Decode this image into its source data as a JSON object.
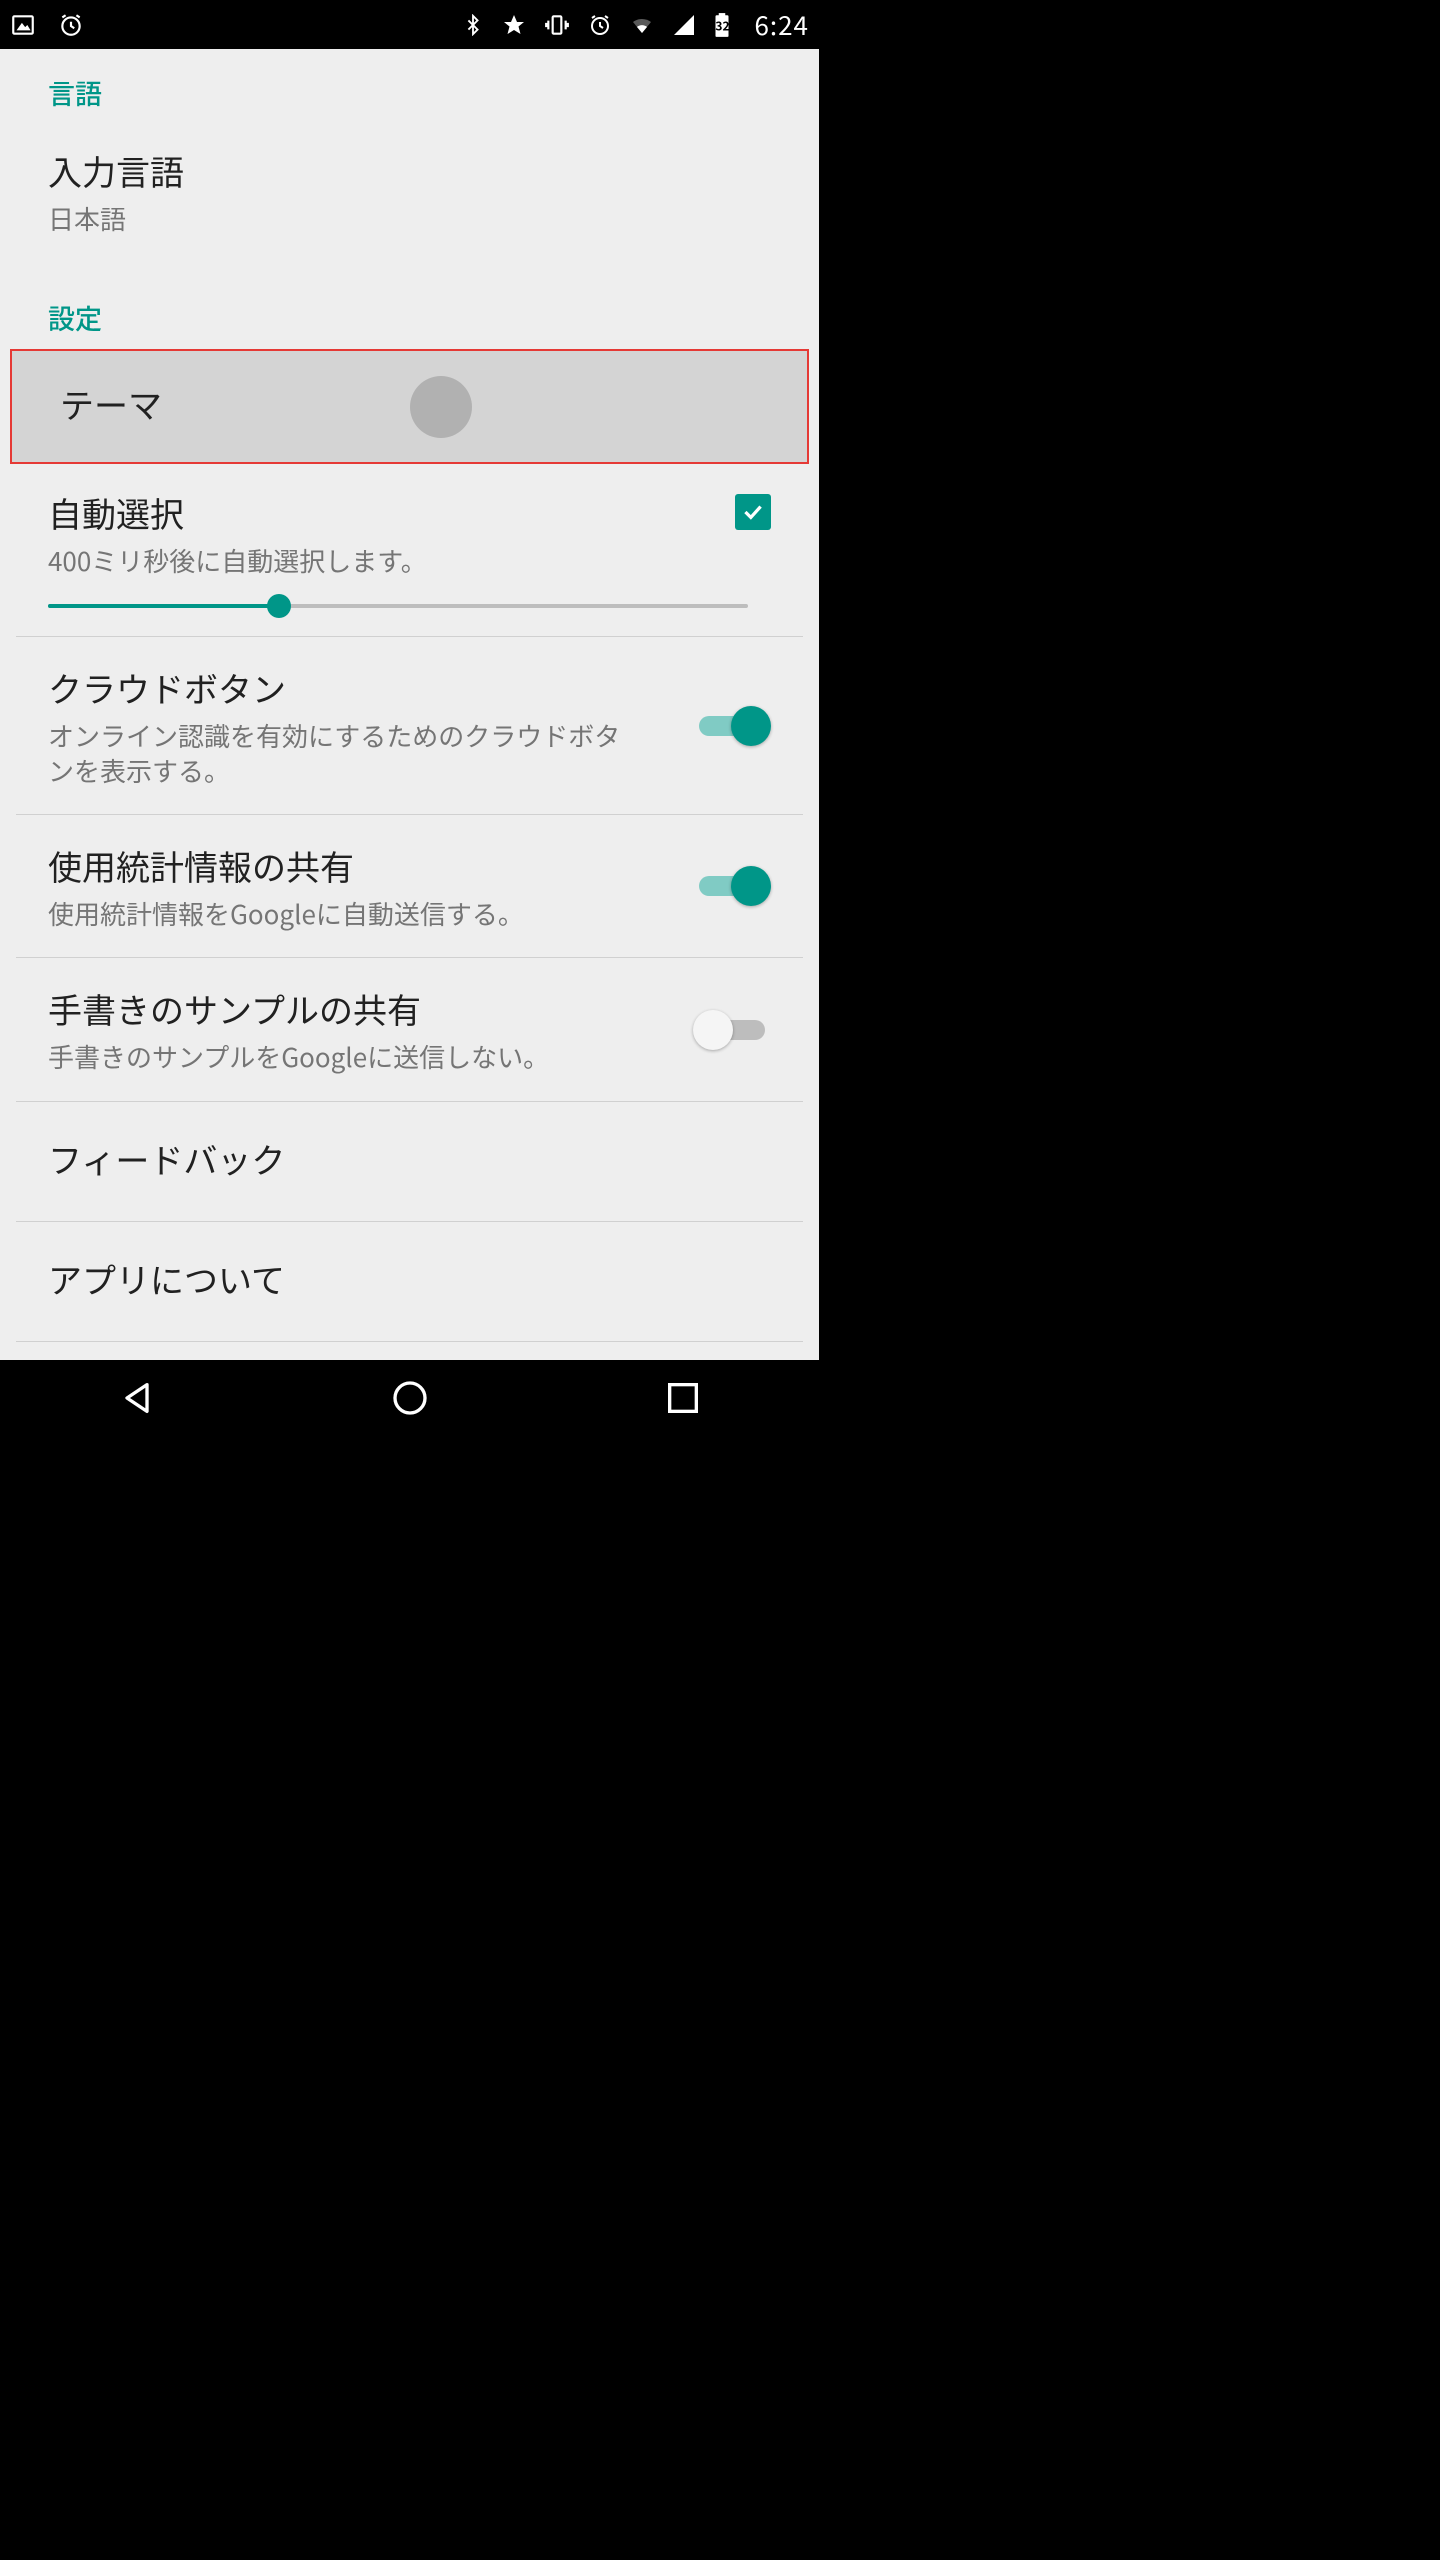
{
  "status": {
    "time": "6:24",
    "battery_label": "32"
  },
  "sections": {
    "language": {
      "header": "言語",
      "input_language": {
        "title": "入力言語",
        "value": "日本語"
      }
    },
    "settings": {
      "header": "設定",
      "theme": {
        "title": "テーマ"
      },
      "auto_select": {
        "title": "自動選択",
        "subtitle": "400ミリ秒後に自動選択します。",
        "checked": true,
        "slider_percent": 33
      },
      "cloud_button": {
        "title": "クラウドボタン",
        "subtitle": "オンライン認識を有効にするためのクラウドボタンを表示する。",
        "on": true
      },
      "usage_stats": {
        "title": "使用統計情報の共有",
        "subtitle": "使用統計情報をGoogleに自動送信する。",
        "on": true
      },
      "handwriting_share": {
        "title": "手書きのサンプルの共有",
        "subtitle": "手書きのサンプルをGoogleに送信しない。",
        "on": false
      },
      "feedback": {
        "title": "フィードバック"
      },
      "about": {
        "title": "アプリについて"
      }
    }
  }
}
